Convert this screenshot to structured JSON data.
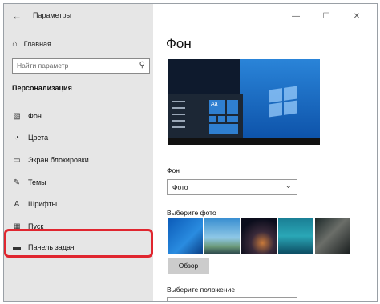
{
  "window": {
    "title": "Параметры",
    "controls": {
      "minimize": "—",
      "maximize": "☐",
      "close": "✕"
    }
  },
  "sidebar": {
    "home_label": "Главная",
    "search_placeholder": "Найти параметр",
    "section_title": "Персонализация",
    "items": [
      {
        "label": "Фон",
        "icon": "image-icon"
      },
      {
        "label": "Цвета",
        "icon": "palette-icon"
      },
      {
        "label": "Экран блокировки",
        "icon": "lock-screen-icon"
      },
      {
        "label": "Темы",
        "icon": "brush-icon"
      },
      {
        "label": "Шрифты",
        "icon": "font-icon"
      },
      {
        "label": "Пуск",
        "icon": "start-icon"
      },
      {
        "label": "Панель задач",
        "icon": "taskbar-icon"
      }
    ],
    "highlighted_item": "Панель задач"
  },
  "main": {
    "title": "Фон",
    "preview_tile_label": "Aa",
    "background_label": "Фон",
    "background_value": "Фото",
    "choose_photo_label": "Выберите фото",
    "browse_button": "Обзор",
    "position_label": "Выберите положение"
  },
  "colors": {
    "highlight": "#e0262f",
    "sidebar_bg": "#e6e6e6",
    "accent": "#2f7fd0"
  }
}
